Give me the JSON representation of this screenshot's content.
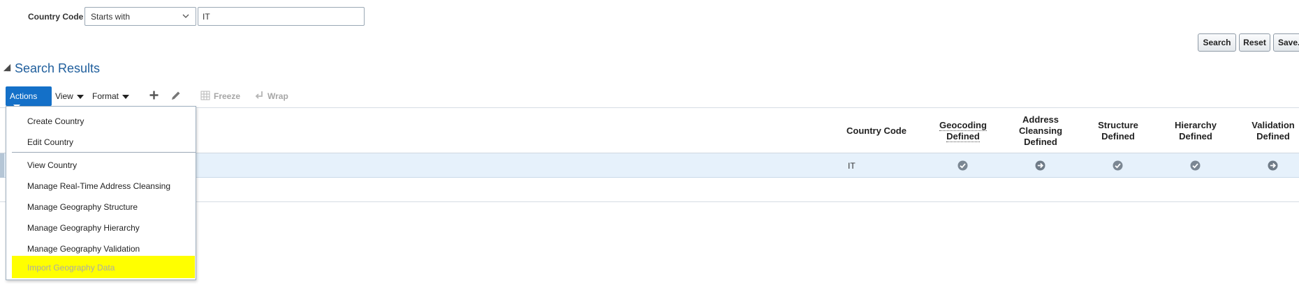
{
  "search": {
    "label": "Country Code",
    "operator": "Starts with",
    "value": "IT",
    "buttons": {
      "search": "Search",
      "reset": "Reset",
      "save": "Save..."
    }
  },
  "results": {
    "title": "Search Results",
    "toolbar": {
      "actions": "Actions",
      "view": "View",
      "format": "Format",
      "freeze": "Freeze",
      "wrap": "Wrap"
    },
    "columns": {
      "country_code": "Country Code",
      "geocoding": [
        "Geocoding",
        "Defined"
      ],
      "address": [
        "Address",
        "Cleansing",
        "Defined"
      ],
      "structure": [
        "Structure",
        "Defined"
      ],
      "hierarchy": [
        "Hierarchy",
        "Defined"
      ],
      "validation": [
        "Validation",
        "Defined"
      ]
    },
    "rows": [
      {
        "country_code": "IT",
        "status": [
          "check-circle-icon",
          "arrow-circle-icon",
          "check-circle-icon",
          "check-circle-icon",
          "arrow-circle-icon"
        ]
      }
    ]
  },
  "menu": {
    "items": [
      "Create Country",
      "Edit Country",
      "View Country",
      "Manage Real-Time Address Cleansing",
      "Manage Geography Structure",
      "Manage Geography Hierarchy",
      "Manage Geography Validation",
      "Import Geography Data"
    ]
  },
  "colors": {
    "accent": "#1470c8",
    "title": "#1f5e9c",
    "highlight": "#ffff00",
    "selected_row": "#e6f1fb"
  }
}
